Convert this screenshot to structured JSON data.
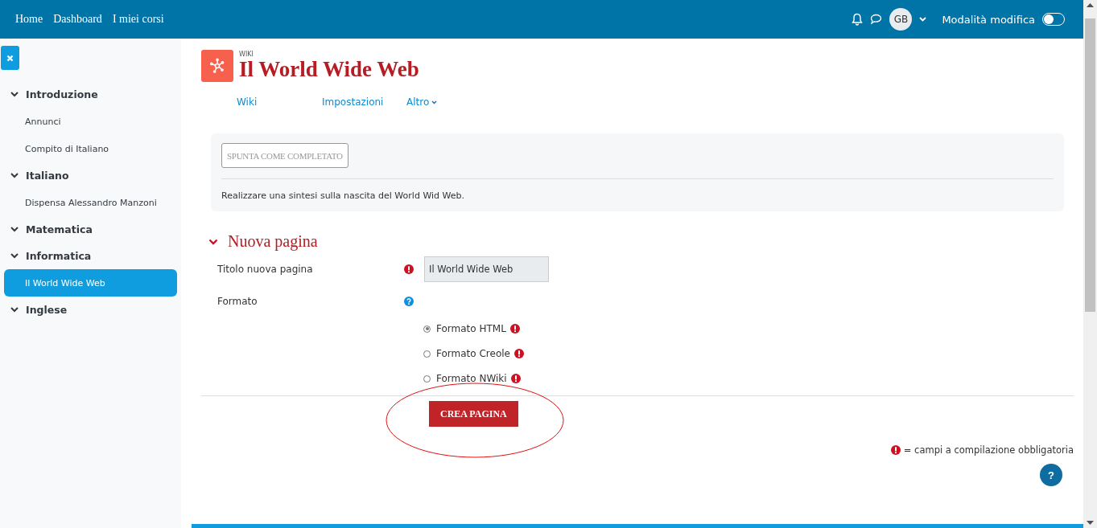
{
  "navbar": {
    "links": [
      "Home",
      "Dashboard",
      "I miei corsi"
    ],
    "avatar": "GB",
    "edit_mode": {
      "label": "Modalità modifica",
      "on": false
    }
  },
  "sidebar": {
    "sections": [
      {
        "title": "Introduzione",
        "expanded": true,
        "children": [
          {
            "label": "Annunci",
            "selected": false
          },
          {
            "label": "Compito di Italiano",
            "selected": false
          }
        ]
      },
      {
        "title": "Italiano",
        "expanded": true,
        "children": [
          {
            "label": "Dispensa Alessandro Manzoni",
            "selected": false
          }
        ]
      },
      {
        "title": "Matematica",
        "expanded": true
      },
      {
        "title": "Informatica",
        "expanded": true,
        "children": [
          {
            "label": "Il World Wide Web",
            "selected": true
          }
        ]
      },
      {
        "title": "Inglese",
        "expanded": true
      }
    ]
  },
  "header": {
    "kind_label": "WIKI",
    "title": "Il World Wide Web"
  },
  "tabs": [
    {
      "label": "Wiki",
      "dropdown": false
    },
    {
      "label": "Impostazioni",
      "dropdown": false
    },
    {
      "label": "Altro",
      "dropdown": true
    }
  ],
  "completion": {
    "button": "SPUNTA COME COMPLETATO",
    "description": "Realizzare una sintesi sulla nascita del World Wid Web."
  },
  "form": {
    "section_title": "Nuova pagina",
    "expanded": true,
    "title_field": {
      "label": "Titolo nuova pagina",
      "required": true,
      "value": "Il World Wide Web"
    },
    "format": {
      "label": "Formato",
      "options": [
        {
          "label": "Formato HTML",
          "selected": true
        },
        {
          "label": "Formato Creole",
          "selected": false
        },
        {
          "label": "Formato NWiki",
          "selected": false
        }
      ]
    },
    "submit": "CREA PAGINA",
    "required_note": "= campi a compilazione obbligatoria"
  },
  "help_button": "?"
}
